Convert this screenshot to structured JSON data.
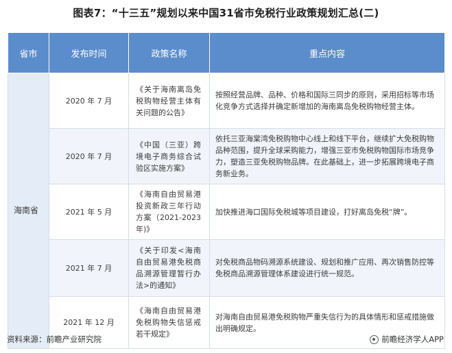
{
  "title": "图表7：“十三五”规划以来中国31省市免税行业政策规划汇总(二)",
  "table": {
    "headers": [
      "省市",
      "发布时间",
      "政策名称",
      "重点内容"
    ],
    "province": "海南省",
    "rows": [
      {
        "date": "2020 年 7 月",
        "name": "《关于海南离岛免税购物经营主体有关问题的公告》",
        "content": "按照经营品牌、品种、价格和国际三同步的原则，采用招标等市场化竞争方式选择并确定新增加的海南离岛免税购物经营主体。"
      },
      {
        "date": "2020 年 7 月",
        "name": "《中国（三亚）跨境电子商务综合试验区实施方案》",
        "content": "依托三亚海棠湾免税购物中心线上和线下平台，继续扩大免税购物品种范围，提升全球采购能力，增强三亚市免税购物国际市场竞争力，塑造三亚免税购物品牌。在此基础上，进一步拓展跨境电子商务新业务。"
      },
      {
        "date": "2021 年 5 月",
        "name": "《海南自由贸易港投资新政三年行动方案（2021-2023年)》",
        "content": "加快推进海口国际免税城等项目建设，打好离岛免税“牌”。"
      },
      {
        "date": "2021 年 7 月",
        "name": "《关于印发<海南自由贸易港免税商品溯源管理暂行办法>的通知》",
        "content": "对免税商品物码溯源系统建设、规划和推广应用、再次销售防控等免税商品溯源管理体系建设进行统一规范。"
      },
      {
        "date": "2021 年 12 月",
        "name": "《海南自由贸易港免税购物失信惩戒若干规定》",
        "content": "对海南自由贸易港免税购物严重失信行为的具体情形和惩戒措施做出明确规定。"
      }
    ]
  },
  "watermark": "前瞻产业研究院",
  "footer": {
    "source": "资料来源：前瞻产业研究院",
    "brand": "前瞻经济学人APP",
    "brand_icon": "qianzhan-logo-icon"
  },
  "colors": {
    "header_bg": "#5b8ccc",
    "province_bg": "#e4ecf7",
    "alt_row_bg": "#f1f5fb"
  }
}
